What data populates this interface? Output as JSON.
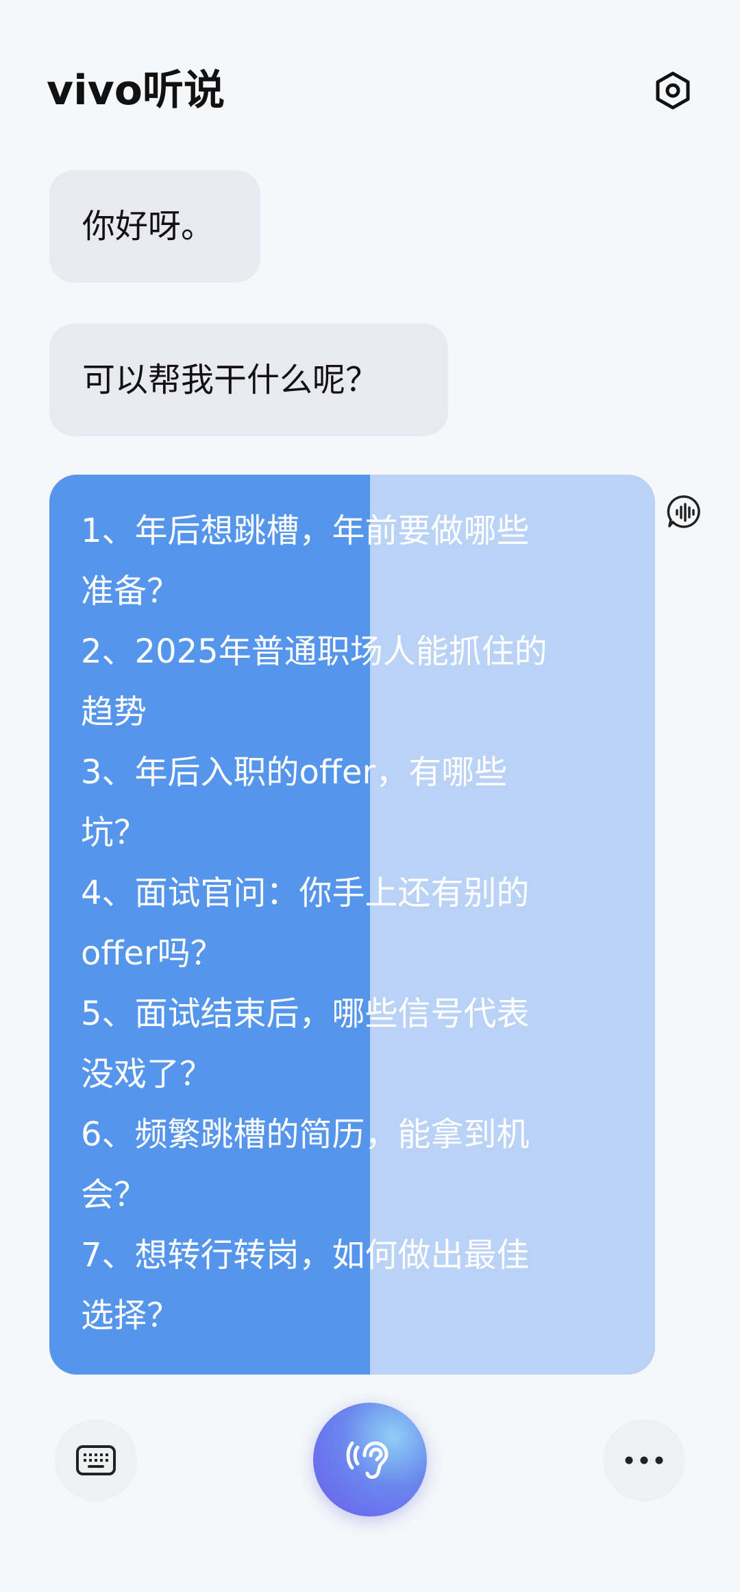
{
  "header": {
    "title": "vivo听说",
    "settings_icon": "settings-hexagon-icon"
  },
  "messages": {
    "user_1": "你好呀。",
    "user_2": "可以帮我干什么呢？",
    "reply_lines": [
      "1、年后想跳槽，年前要做哪些",
      "准备？",
      "2、2025年普通职场人能抓住的",
      "趋势",
      "3、年后入职的offer，有哪些",
      "坑？",
      "4、面试官问：你手上还有别的",
      "offer吗？",
      "5、面试结束后，哪些信号代表",
      "没戏了？",
      "6、频繁跳槽的简历，能拿到机",
      "会？",
      "7、想转行转岗，如何做出最佳",
      "选择？"
    ],
    "reply_voice_icon": "voice-wave-bubble-icon"
  },
  "colors": {
    "reply_read": "#5596ec",
    "reply_unread": "#b9d2f5",
    "user_bubble": "#e9eaf1",
    "listen_button": "#6a86ee"
  },
  "bottom_bar": {
    "keyboard_icon": "keyboard-icon",
    "listen_icon": "ear-listen-icon",
    "more_icon": "more-dots-icon"
  }
}
